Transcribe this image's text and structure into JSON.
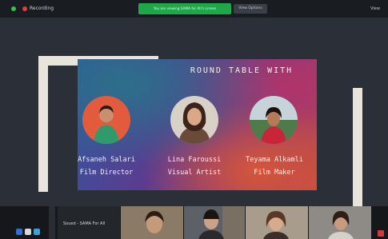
{
  "topbar": {
    "recording_label": "Recording",
    "share_banner": "You are viewing SAMA for All's screen",
    "view_options_label": "View Options",
    "view_label": "View"
  },
  "slide": {
    "title": "ROUND TABLE WITH",
    "people": [
      {
        "name": "Afsaneh Salari",
        "role": "Film Director"
      },
      {
        "name": "Lina Faroussi",
        "role": "Visual Artist"
      },
      {
        "name": "Teyama Alkamli",
        "role": "Film Maker"
      }
    ]
  },
  "gallery": {
    "self_name": "Soued - SAMA For All"
  },
  "colors": {
    "topbar": "#191c21",
    "screen_bg": "#2b3038",
    "frame": "#e8e4dc",
    "share_green": "#1ea84a",
    "recording_red": "#e23b3b"
  }
}
